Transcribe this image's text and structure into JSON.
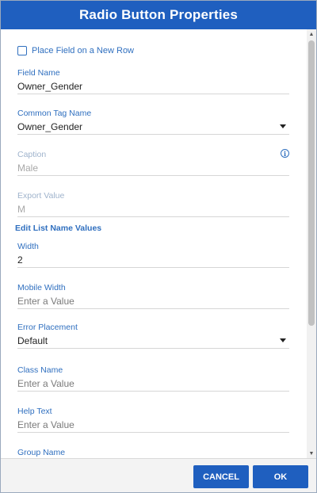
{
  "dialog": {
    "title": "Radio Button Properties"
  },
  "checkbox": {
    "label": "Place Field on a New Row",
    "checked": false
  },
  "fields": {
    "field_name": {
      "label": "Field Name",
      "value": "Owner_Gender"
    },
    "common_tag_name": {
      "label": "Common Tag Name",
      "value": "Owner_Gender"
    },
    "caption": {
      "label": "Caption",
      "value": "Male"
    },
    "export_value": {
      "label": "Export Value",
      "value": "M"
    },
    "width": {
      "label": "Width",
      "value": "2"
    },
    "mobile_width": {
      "label": "Mobile Width",
      "placeholder": "Enter a Value"
    },
    "error_placement": {
      "label": "Error Placement",
      "value": "Default"
    },
    "class_name": {
      "label": "Class Name",
      "placeholder": "Enter a Value"
    },
    "help_text": {
      "label": "Help Text",
      "placeholder": "Enter a Value"
    },
    "group_name": {
      "label": "Group Name"
    }
  },
  "section": {
    "edit_list_heading": "Edit List Name Values"
  },
  "icons": {
    "info": "info-icon",
    "dropdown": "chevron-down-icon"
  },
  "icon_glyphs": {
    "info": "i"
  },
  "footer": {
    "cancel_label": "CANCEL",
    "ok_label": "OK"
  },
  "colors": {
    "titlebar": "#1f5fbf",
    "label": "#2f6fbf",
    "button": "#1f5fbf"
  }
}
